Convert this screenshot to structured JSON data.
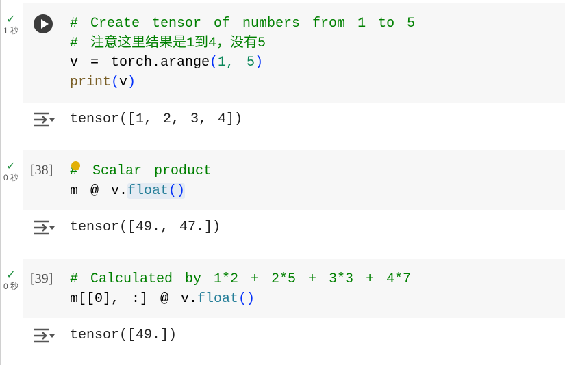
{
  "cells": [
    {
      "status": "1 秒",
      "exec_count": "",
      "lines": {
        "c1": "# Create tensor of numbers from 1 to 5",
        "c2": "# 注意这里结果是1到4，没有5",
        "l3a": "v = torch.arange",
        "l3b": "(",
        "l3c": "1, 5",
        "l3d": ")",
        "l4a": "print",
        "l4b": "(",
        "l4c": "v",
        "l4d": ")"
      },
      "output": "tensor([1, 2, 3, 4])"
    },
    {
      "status": "0 秒",
      "exec_count": "[38]",
      "lines": {
        "c1a": "#",
        "c1b": " Scalar product",
        "l2a": "m @ v.",
        "l2b": "float",
        "l2c": "()"
      },
      "output": "tensor([49., 47.])"
    },
    {
      "status": "0 秒",
      "exec_count": "[39]",
      "lines": {
        "c1": "# Calculated by 1*2 + 2*5 + 3*3 + 4*7",
        "l2a": "m[[0], :] @ v.",
        "l2b": "float",
        "l2c": "()"
      },
      "output": "tensor([49.])"
    }
  ],
  "colors": {
    "comment": "#008000",
    "success": "#1e8e3e",
    "cell_bg": "#f7f7f7"
  },
  "icons": {
    "run": "play-circle-icon",
    "status": "check-icon",
    "output": "output-collapse-icon",
    "hint": "lightbulb-icon"
  }
}
